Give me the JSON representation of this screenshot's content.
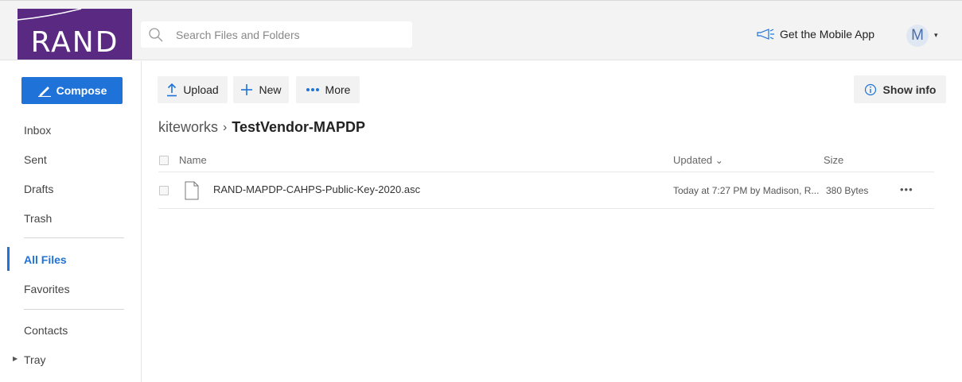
{
  "brand": {
    "logo_text": "RAND",
    "logo_color": "#5a2a82"
  },
  "search": {
    "placeholder": "Search Files and Folders",
    "value": ""
  },
  "header": {
    "mobile_app_label": "Get the Mobile App",
    "avatar_initial": "M"
  },
  "sidebar": {
    "compose_label": "Compose",
    "items": [
      {
        "label": "Inbox"
      },
      {
        "label": "Sent"
      },
      {
        "label": "Drafts"
      },
      {
        "label": "Trash"
      },
      {
        "label": "All Files",
        "active": true
      },
      {
        "label": "Favorites"
      },
      {
        "label": "Contacts"
      },
      {
        "label": "Tray"
      }
    ]
  },
  "toolbar": {
    "upload_label": "Upload",
    "new_label": "New",
    "more_label": "More",
    "show_info_label": "Show info"
  },
  "breadcrumb": {
    "root": "kiteworks",
    "separator": "›",
    "current": "TestVendor-MAPDP"
  },
  "table": {
    "columns": {
      "name": "Name",
      "updated": "Updated",
      "size": "Size"
    },
    "sort_indicator": "⌄",
    "rows": [
      {
        "name": "RAND-MAPDP-CAHPS-Public-Key-2020.asc",
        "updated": "Today at 7:27 PM by Madison, R...",
        "size": "380 Bytes",
        "actions": "•••"
      }
    ]
  },
  "colors": {
    "accent": "#1f73d8",
    "header_bg": "#f3f3f3"
  }
}
